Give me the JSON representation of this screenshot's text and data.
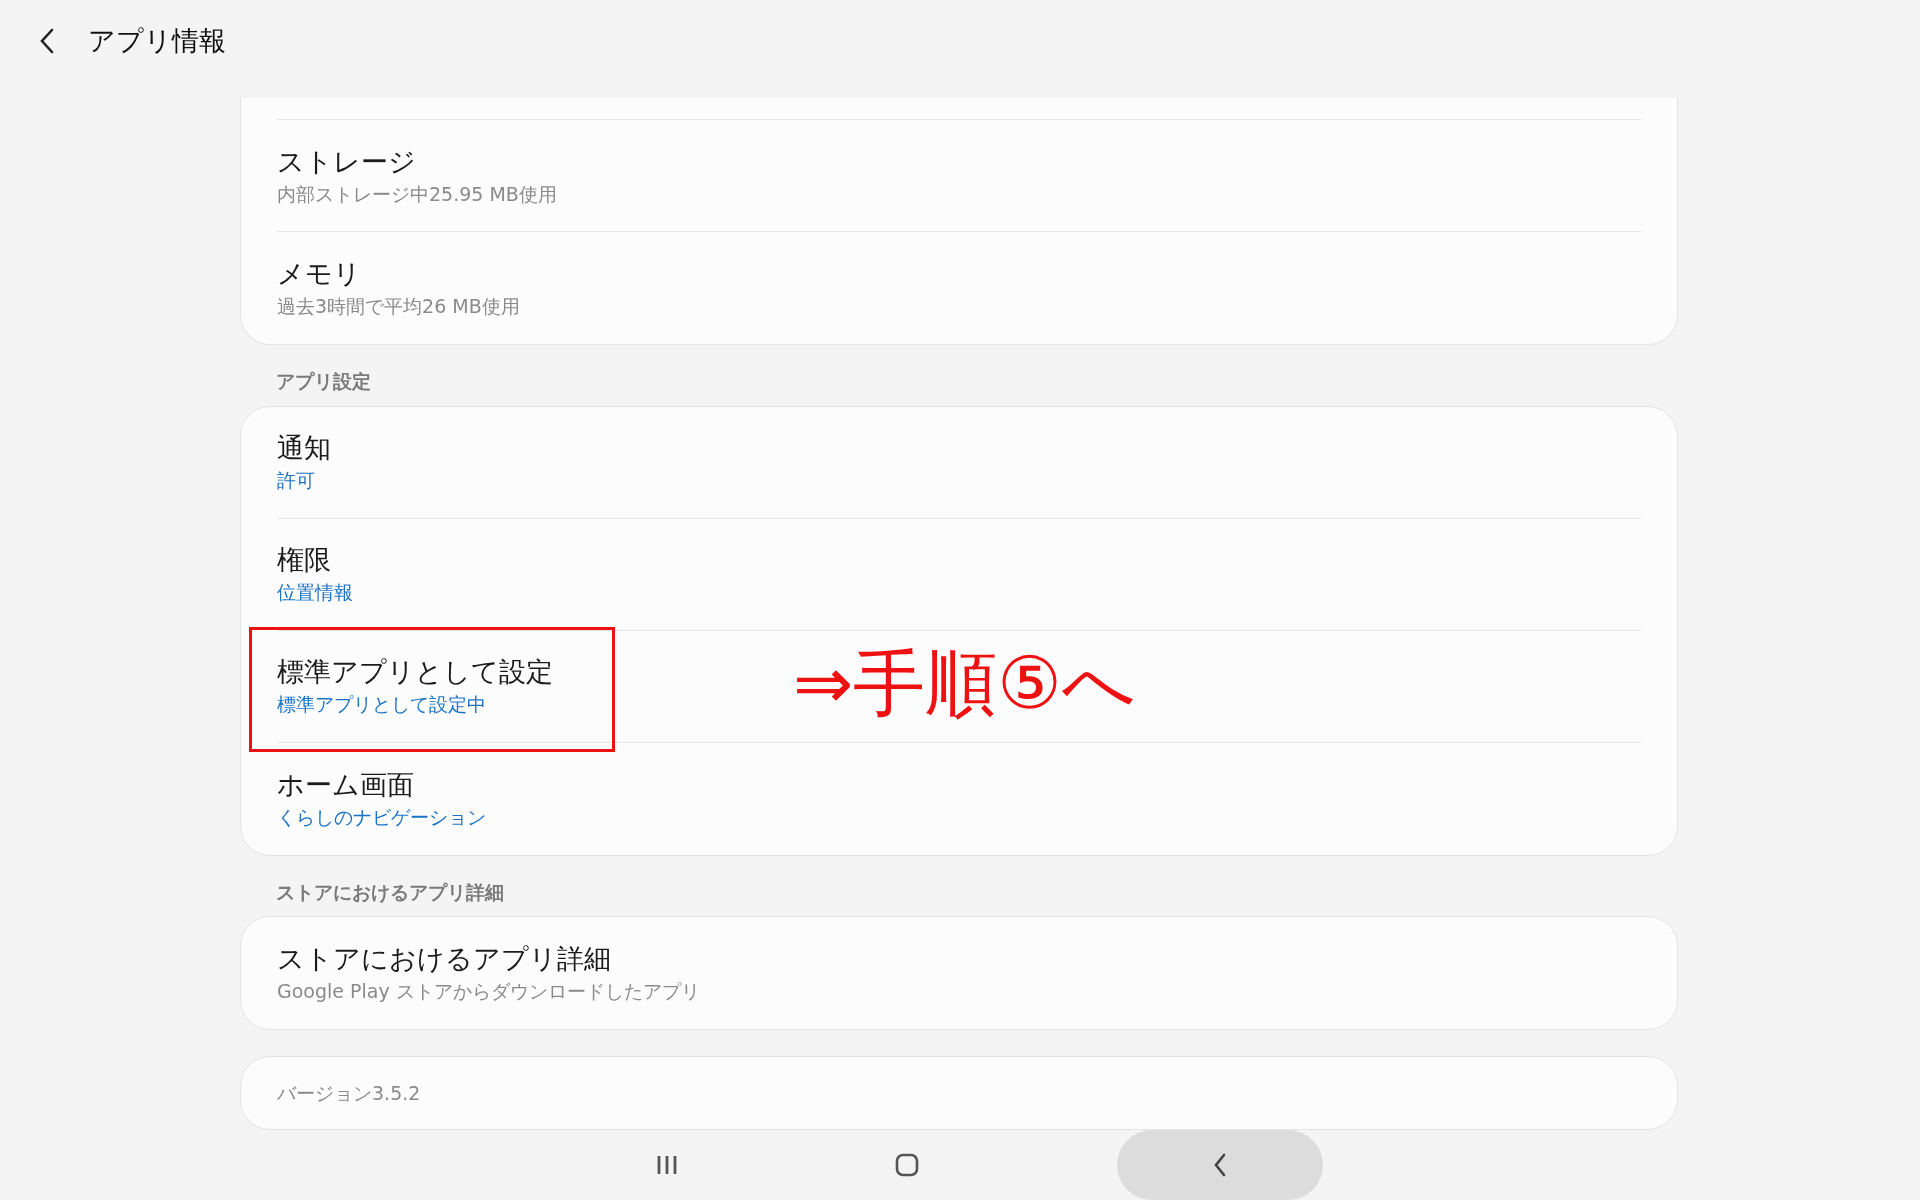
{
  "header": {
    "title": "アプリ情報"
  },
  "sections": [
    {
      "clipped_top": true,
      "rows": [
        {
          "title": "ストレージ",
          "subtitle": "内部ストレージ中25.95 MB使用",
          "kind": "muted",
          "highlighted": false
        },
        {
          "title": "メモリ",
          "subtitle": "過去3時間で平均26 MB使用",
          "kind": "muted",
          "highlighted": false
        }
      ]
    },
    {
      "label": "アプリ設定",
      "clipped_top": false,
      "rows": [
        {
          "title": "通知",
          "subtitle": "許可",
          "kind": "accent",
          "highlighted": false
        },
        {
          "title": "権限",
          "subtitle": "位置情報",
          "kind": "accent",
          "highlighted": false
        },
        {
          "title": "標準アプリとして設定",
          "subtitle": "標準アプリとして設定中",
          "kind": "accent",
          "highlighted": true
        },
        {
          "title": "ホーム画面",
          "subtitle": "くらしのナビゲーション",
          "kind": "accent",
          "highlighted": false
        }
      ]
    },
    {
      "label": "ストアにおけるアプリ詳細",
      "clipped_top": false,
      "rows": [
        {
          "title": "ストアにおけるアプリ詳細",
          "subtitle": "Google Play ストアからダウンロードしたアプリ",
          "kind": "muted",
          "highlighted": false
        }
      ]
    }
  ],
  "version": "バージョン3.5.2",
  "annotation": {
    "text": "⇒手順⑤へ"
  }
}
